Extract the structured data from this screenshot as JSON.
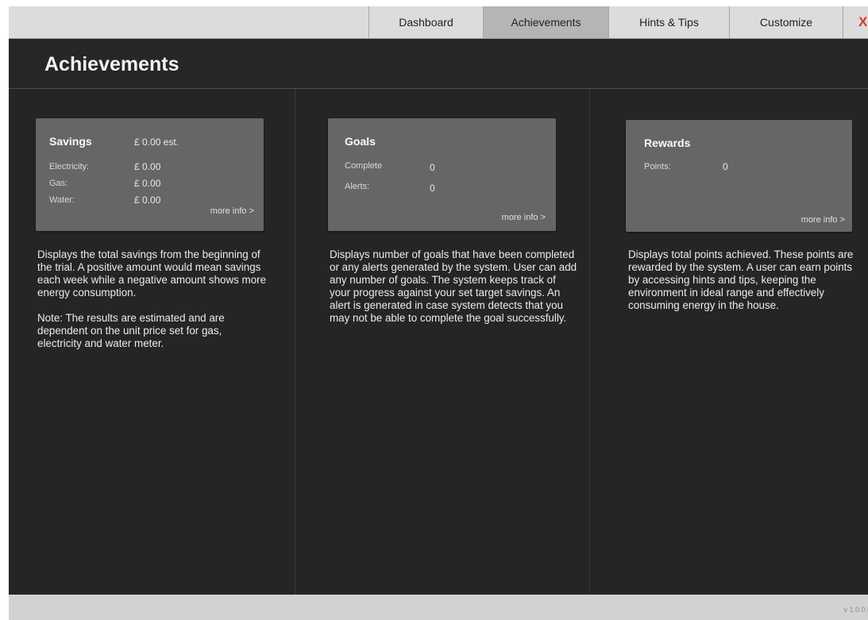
{
  "nav": {
    "tabs": [
      "Dashboard",
      "Achievements",
      "Hints & Tips",
      "Customize"
    ],
    "active_tab": "Achievements",
    "close_label": "X"
  },
  "page_title": "Achievements",
  "savings": {
    "title": "Savings",
    "total": "£ 0.00 est.",
    "rows": [
      {
        "label": "Electricity:",
        "value": "£ 0.00"
      },
      {
        "label": "Gas:",
        "value": "£ 0.00"
      },
      {
        "label": "Water:",
        "value": "£ 0.00"
      }
    ],
    "more_label": "more info >",
    "description": [
      "Displays the total savings from the beginning of the trial.  A positive amount would mean savings each week while a negative amount shows more energy consumption.",
      "Note: The results are estimated and are dependent on the unit price set for gas, electricity and water meter."
    ]
  },
  "goals": {
    "title": "Goals",
    "rows": [
      {
        "label": "Complete",
        "value": "0"
      },
      {
        "label": "Alerts:",
        "value": "0"
      }
    ],
    "more_label": "more info >",
    "description": "Displays number of goals that have been completed or any alerts generated by the system. User can add any number of goals. The system keeps track of your progress against your set target savings.  An alert is generated in case system detects that you may not be able to complete the goal successfully."
  },
  "rewards": {
    "title": "Rewards",
    "rows": [
      {
        "label": "Points:",
        "value": "0"
      }
    ],
    "more_label": "more info >",
    "description": "Displays total points achieved. These points are rewarded by the system. A user can earn points by accessing hints and tips, keeping the environment in ideal range and effectively consuming energy in the house."
  },
  "footer": {
    "version": "v 1.0.0.0"
  },
  "colors": {
    "background": "#252525",
    "card": "#666666",
    "topbar": "#dcdcdc",
    "active_tab": "#b5b5b5",
    "close": "#d23a2a"
  }
}
